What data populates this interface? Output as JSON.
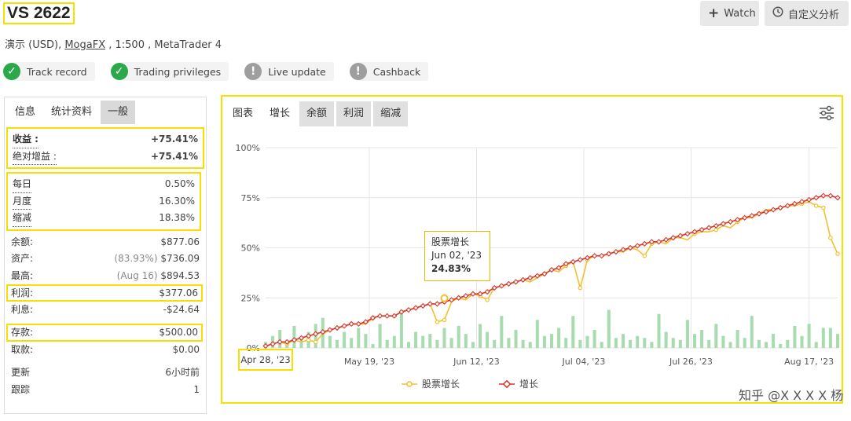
{
  "header": {
    "title": "VS 2622",
    "account_type": "演示 (USD)",
    "broker": "MogaFX",
    "leverage": ", 1:500 ,",
    "platform": "MetaTrader 4",
    "watch_label": "Watch",
    "analysis_label": "自定义分析"
  },
  "badges": [
    {
      "label": "Track record",
      "status": "verified",
      "icon": "check-icon"
    },
    {
      "label": "Trading privileges",
      "status": "verified",
      "icon": "check-icon"
    },
    {
      "label": "Live update",
      "status": "unverified",
      "icon": "exclamation-icon"
    },
    {
      "label": "Cashback",
      "status": "unverified",
      "icon": "exclamation-icon"
    }
  ],
  "stats": {
    "tabs": [
      "信息",
      "统计资料",
      "一般"
    ],
    "gain_label": "收益 :",
    "gain_value": "+75.41%",
    "abs_gain_label": "绝对增益 :",
    "abs_gain_value": "+75.41%",
    "daily_label": "每日",
    "daily_value": "0.50%",
    "monthly_label": "月度",
    "monthly_value": "16.30%",
    "drawdown_label": "缩减",
    "drawdown_value": "18.38%",
    "balance_label": "余额:",
    "balance_value": "$877.06",
    "equity_label": "资产:",
    "equity_pct": "(83.93%)",
    "equity_value": "$736.09",
    "highest_label": "最高:",
    "highest_date": "(Aug 16)",
    "highest_value": "$894.53",
    "profit_label": "利润:",
    "profit_value": "$377.06",
    "interest_label": "利息:",
    "interest_value": "-$24.64",
    "deposits_label": "存款:",
    "deposits_value": "$500.00",
    "withdrawals_label": "取款:",
    "withdrawals_value": "$0.00",
    "updated_label": "更新",
    "updated_value": "6小时前",
    "tracking_label": "跟踪",
    "tracking_value": "1"
  },
  "chart_tabs": [
    "图表",
    "增长",
    "余额",
    "利润",
    "缩减"
  ],
  "tooltip": {
    "series": "股票增长",
    "date": "Jun 02, '23",
    "value": "24.83%"
  },
  "watermark": "知乎 @X X X X 杨",
  "colors": {
    "equity": "#f2c12e",
    "growth": "#d9352b",
    "bars": "#a8dbb0",
    "accent_highlight": "#f5e000"
  },
  "chart_data": {
    "type": "line",
    "x_labels": [
      "Apr 28, '23",
      "May 19, '23",
      "Jun 12, '23",
      "Jul 04, '23",
      "Jul 26, '23",
      "Aug 17, '23"
    ],
    "y_ticks": [
      "0%",
      "25%",
      "50%",
      "75%",
      "100%"
    ],
    "ylim": [
      0,
      100
    ],
    "n_points": 81,
    "series": [
      {
        "name": "股票增长",
        "values": [
          1,
          2,
          3,
          2,
          4,
          3,
          4,
          3,
          7,
          9,
          10,
          11,
          12,
          12,
          12,
          15,
          16,
          16,
          16,
          18,
          19,
          20,
          21,
          22,
          13,
          14,
          23,
          25,
          24,
          27,
          26,
          24,
          30,
          31,
          32,
          33,
          34,
          33,
          35,
          37,
          39,
          38,
          41,
          43,
          30,
          44,
          46,
          46,
          47,
          48,
          48,
          50,
          49,
          46,
          52,
          53,
          52,
          55,
          55,
          54,
          57,
          58,
          58,
          59,
          61,
          60,
          63,
          65,
          65,
          67,
          69,
          69,
          70,
          71,
          71,
          72,
          73,
          71,
          70,
          55,
          47
        ]
      },
      {
        "name": "增长",
        "values": [
          1,
          2,
          3,
          3,
          4,
          5,
          6,
          7,
          8,
          9,
          10,
          11,
          12,
          12,
          13,
          15,
          16,
          16,
          16,
          18,
          19,
          20,
          21,
          22,
          22,
          23,
          24,
          25,
          26,
          27,
          27,
          28,
          30,
          31,
          32,
          33,
          34,
          35,
          36,
          37,
          39,
          40,
          42,
          43,
          44,
          45,
          46,
          46,
          47,
          48,
          49,
          50,
          51,
          52,
          53,
          53,
          54,
          55,
          56,
          57,
          58,
          59,
          60,
          61,
          62,
          63,
          64,
          65,
          66,
          67,
          68,
          69,
          70,
          71,
          72,
          73,
          74,
          75,
          76,
          76,
          75
        ]
      }
    ],
    "bars": [
      3,
      6,
      9,
      4,
      11,
      5,
      8,
      12,
      15,
      6,
      4,
      8,
      5,
      10,
      7,
      2,
      12,
      4,
      6,
      19,
      3,
      8,
      6,
      7,
      4,
      10,
      5,
      11,
      7,
      3,
      12,
      8,
      4,
      16,
      5,
      9,
      4,
      3,
      14,
      6,
      7,
      10,
      5,
      16,
      4,
      6,
      9,
      3,
      19,
      5,
      7,
      4,
      6,
      5,
      3,
      17,
      8,
      5,
      4,
      14,
      7,
      9,
      4,
      12,
      6,
      3,
      9,
      5,
      16,
      4,
      3,
      7,
      2,
      4,
      11,
      6,
      12,
      3,
      10,
      10,
      7
    ]
  }
}
